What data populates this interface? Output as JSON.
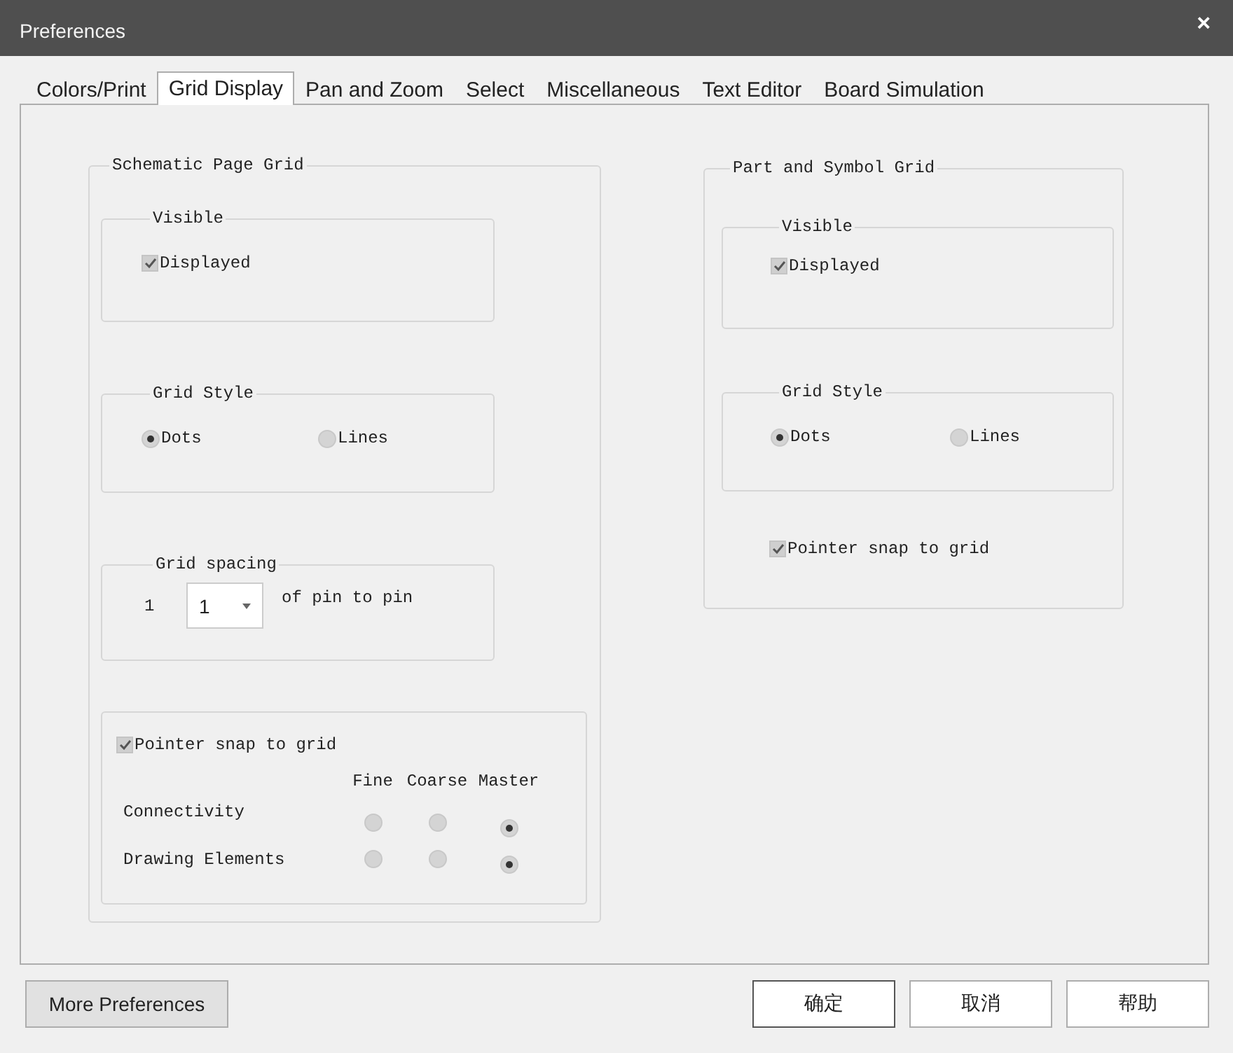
{
  "window": {
    "title": "Preferences",
    "close": "×"
  },
  "tabs": [
    {
      "label": "Colors/Print",
      "selected": false
    },
    {
      "label": "Grid Display",
      "selected": true
    },
    {
      "label": "Pan and Zoom",
      "selected": false
    },
    {
      "label": "Select",
      "selected": false
    },
    {
      "label": "Miscellaneous",
      "selected": false
    },
    {
      "label": "Text Editor",
      "selected": false
    },
    {
      "label": "Board Simulation",
      "selected": false
    }
  ],
  "groups": [
    {
      "title": "Schematic Page Grid",
      "sections": [
        {
          "kind": "checkbox-group",
          "title": "Visible",
          "option": {
            "label": "Displayed",
            "checked": true
          }
        },
        {
          "kind": "radio-group",
          "title": "Grid Style",
          "options": [
            {
              "label": "Dots",
              "selected": true
            },
            {
              "label": "Lines",
              "selected": false
            }
          ]
        },
        {
          "kind": "spacing",
          "title": "Grid spacing",
          "prefix": "1",
          "value": "1",
          "suffix": "of pin to pin"
        },
        {
          "kind": "snap-matrix",
          "snap": {
            "label": "Pointer snap to grid",
            "checked": true
          },
          "columns": [
            "Fine",
            "Coarse",
            "Master"
          ],
          "rows": [
            {
              "label": "Connectivity",
              "choices": [
                {
                  "selected": false
                },
                {
                  "selected": false
                },
                {
                  "selected": true
                }
              ]
            },
            {
              "label": "Drawing Elements",
              "choices": [
                {
                  "selected": false
                },
                {
                  "selected": false
                },
                {
                  "selected": true
                }
              ]
            }
          ]
        }
      ]
    },
    {
      "title": "Part and Symbol Grid",
      "sections": [
        {
          "kind": "checkbox-group",
          "title": "Visible",
          "option": {
            "label": "Displayed",
            "checked": true
          }
        },
        {
          "kind": "radio-group",
          "title": "Grid Style",
          "options": [
            {
              "label": "Dots",
              "selected": true
            },
            {
              "label": "Lines",
              "selected": false
            }
          ]
        },
        {
          "kind": "checkbox",
          "option": {
            "label": "Pointer snap to grid",
            "checked": true
          }
        }
      ]
    }
  ],
  "footer": {
    "more": "More Preferences",
    "buttons": [
      "确定",
      "取消",
      "帮助"
    ]
  }
}
